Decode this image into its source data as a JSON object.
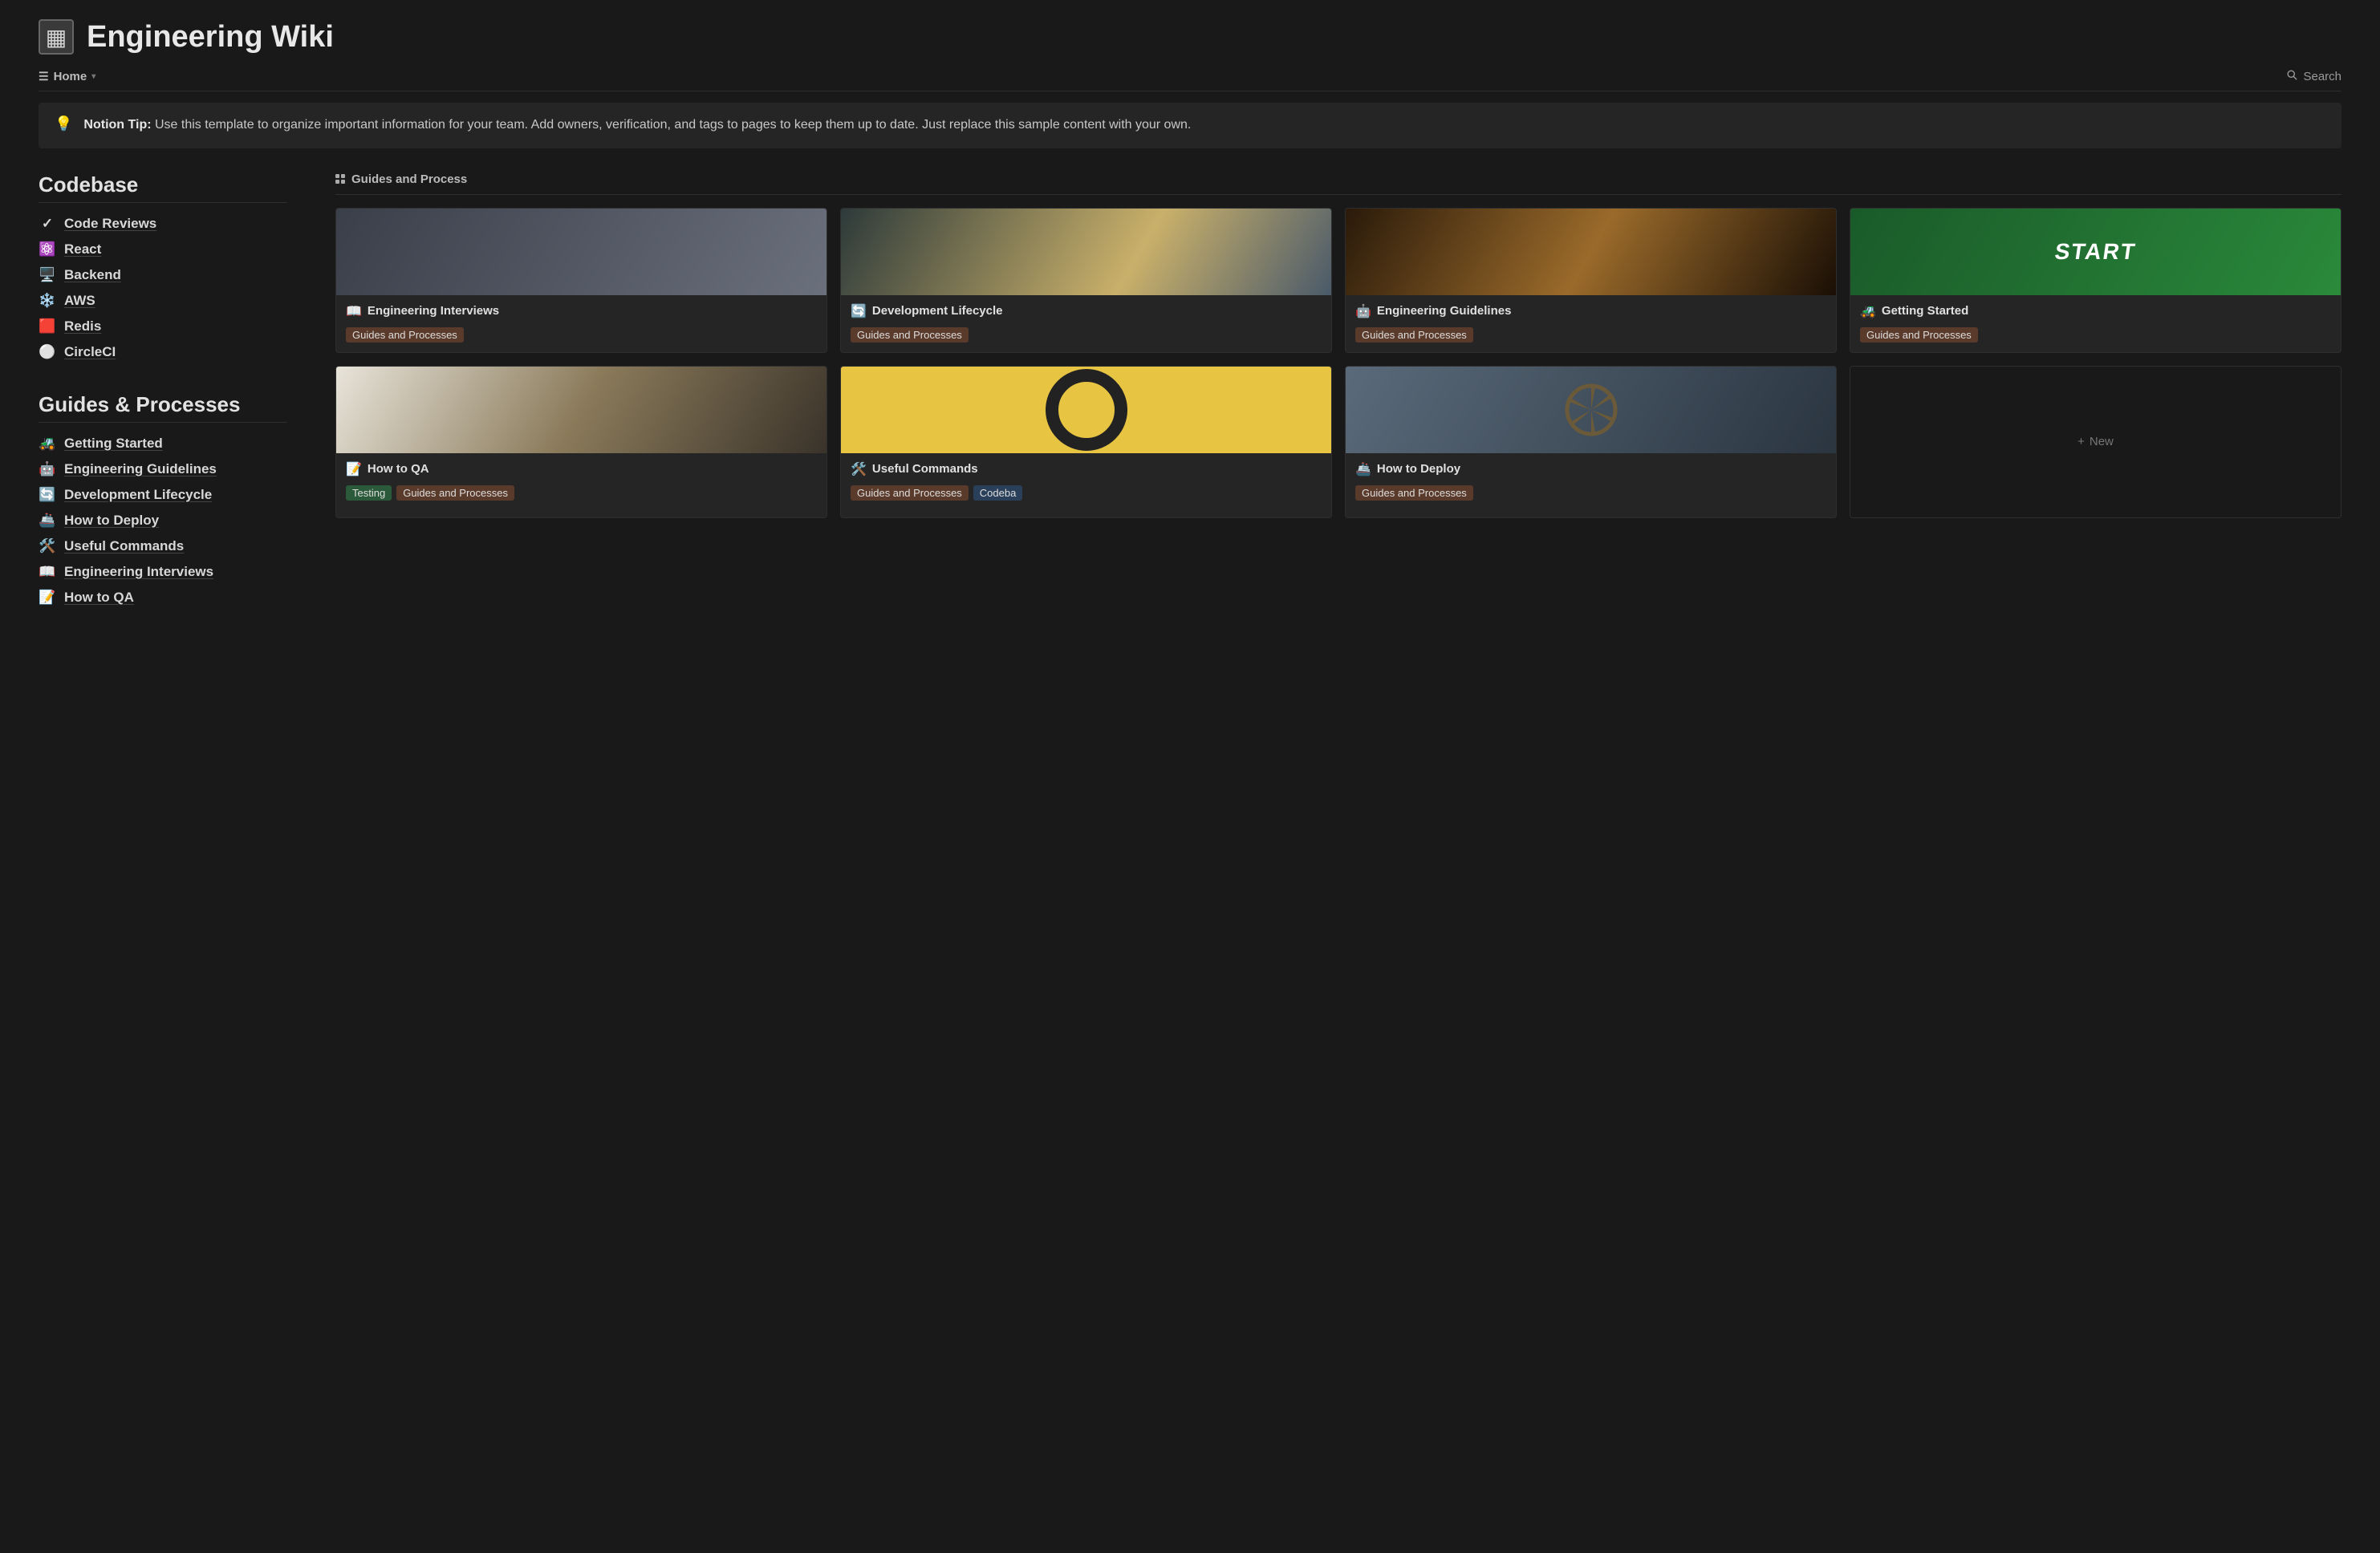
{
  "header": {
    "icon": "▦",
    "title": "Engineering Wiki"
  },
  "viewbar": {
    "tab_label": "Home",
    "search_label": "Search"
  },
  "callout": {
    "icon": "💡",
    "lead": "Notion Tip:",
    "body": "Use this template to organize important information for your team. Add owners, verification, and tags to pages to keep them up to date. Just replace this sample content with your own."
  },
  "sidebar": {
    "sections": [
      {
        "heading": "Codebase",
        "items": [
          {
            "emoji": "✓",
            "label": "Code Reviews"
          },
          {
            "emoji": "⚛️",
            "label": "React"
          },
          {
            "emoji": "🖥️",
            "label": "Backend"
          },
          {
            "emoji": "❄️",
            "label": "AWS"
          },
          {
            "emoji": "🟥",
            "label": "Redis"
          },
          {
            "emoji": "⚪",
            "label": "CircleCI"
          }
        ]
      },
      {
        "heading": "Guides & Processes",
        "items": [
          {
            "emoji": "🚜",
            "label": "Getting Started"
          },
          {
            "emoji": "🤖",
            "label": "Engineering Guidelines"
          },
          {
            "emoji": "🔄",
            "label": "Development Lifecycle"
          },
          {
            "emoji": "🚢",
            "label": "How to Deploy"
          },
          {
            "emoji": "🛠️",
            "label": "Useful Commands"
          },
          {
            "emoji": "📖",
            "label": "Engineering Interviews"
          },
          {
            "emoji": "📝",
            "label": "How to QA"
          }
        ]
      }
    ]
  },
  "gallery": {
    "tab_label": "Guides and Process",
    "new_label": "New",
    "cards": [
      {
        "emoji": "📖",
        "title": "Engineering Interviews",
        "tags": [
          {
            "text": "Guides and Processes",
            "color": "brown"
          }
        ]
      },
      {
        "emoji": "🔄",
        "title": "Development Lifecycle",
        "tags": [
          {
            "text": "Guides and Processes",
            "color": "brown"
          }
        ]
      },
      {
        "emoji": "🤖",
        "title": "Engineering Guidelines",
        "tags": [
          {
            "text": "Guides and Processes",
            "color": "brown"
          }
        ]
      },
      {
        "emoji": "🚜",
        "title": "Getting Started",
        "tags": [
          {
            "text": "Guides and Processes",
            "color": "brown"
          }
        ]
      },
      {
        "emoji": "📝",
        "title": "How to QA",
        "tags": [
          {
            "text": "Testing",
            "color": "green"
          },
          {
            "text": "Guides and Processes",
            "color": "brown"
          }
        ]
      },
      {
        "emoji": "🛠️",
        "title": "Useful Commands",
        "tags": [
          {
            "text": "Guides and Processes",
            "color": "brown"
          },
          {
            "text": "Codeba",
            "color": "blue"
          }
        ]
      },
      {
        "emoji": "🚢",
        "title": "How to Deploy",
        "tags": [
          {
            "text": "Guides and Processes",
            "color": "brown"
          }
        ]
      }
    ]
  }
}
